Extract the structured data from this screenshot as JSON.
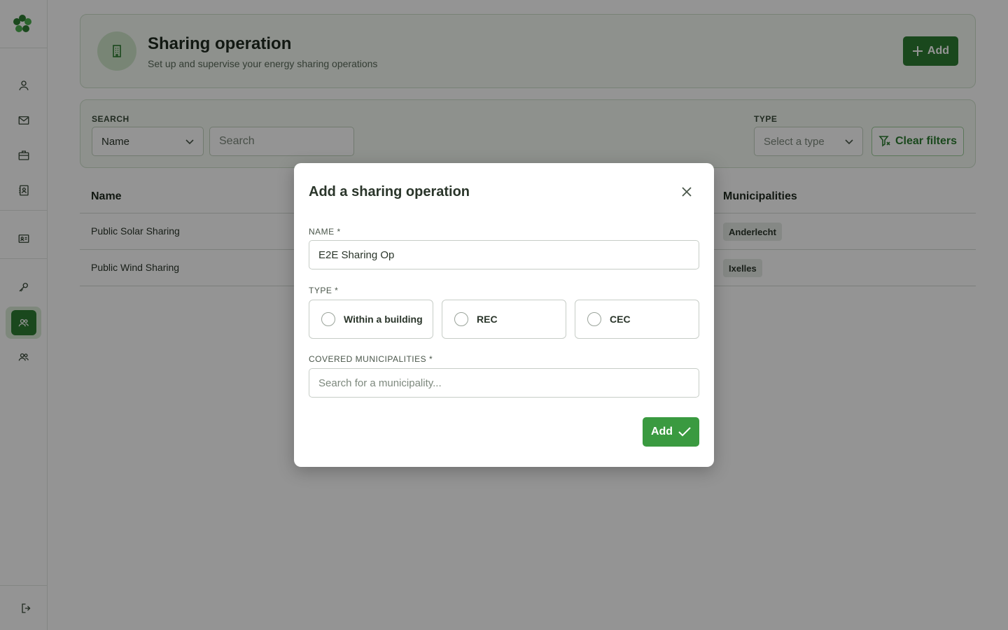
{
  "header": {
    "title": "Sharing operation",
    "subtitle": "Set up and supervise your energy sharing operations",
    "add_label": "Add"
  },
  "filters": {
    "search_label": "SEARCH",
    "search_field_value": "Name",
    "search_placeholder": "Search",
    "type_label": "TYPE",
    "type_placeholder": "Select a type",
    "clear_label": "Clear filters"
  },
  "table": {
    "columns": {
      "name": "Name",
      "municipalities": "Municipalities"
    },
    "rows": [
      {
        "name": "Public Solar Sharing",
        "municipality": "Anderlecht"
      },
      {
        "name": "Public Wind Sharing",
        "municipality": "Ixelles"
      }
    ]
  },
  "modal": {
    "title": "Add a sharing operation",
    "name_label": "NAME *",
    "name_value": "E2E Sharing Op",
    "type_label": "TYPE *",
    "type_options": [
      "Within a building",
      "REC",
      "CEC"
    ],
    "municipalities_label": "COVERED MUNICIPALITIES *",
    "municipalities_placeholder": "Search for a municipality...",
    "submit_label": "Add"
  },
  "colors": {
    "primary": "#2e7d32",
    "submit": "#3a9a40",
    "card_bg": "#f4faf3"
  }
}
